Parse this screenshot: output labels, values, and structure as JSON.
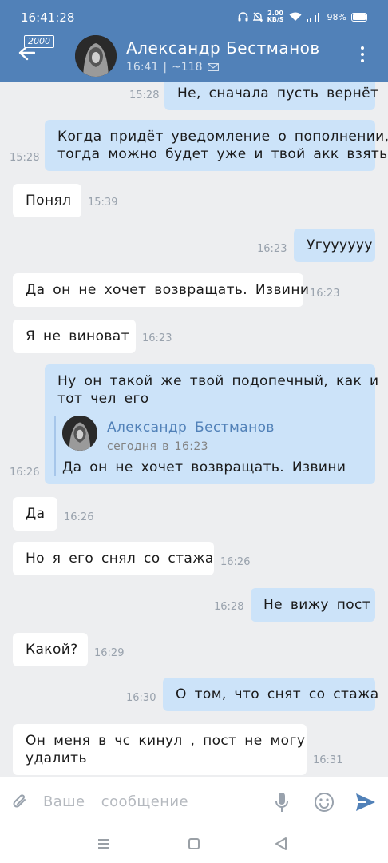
{
  "status_bar": {
    "time": "16:41:28",
    "net_speed_value": "2.00",
    "net_speed_unit": "KB/S",
    "battery": "98%"
  },
  "header": {
    "unread_badge": "2000",
    "contact_name": "Александр  Бестманов",
    "last_seen": "16:41",
    "separator": "|",
    "online_count": "~118",
    "icons": [
      "back-arrow-icon",
      "mail-icon",
      "more-vertical-icon"
    ]
  },
  "messages": [
    {
      "dir": "out",
      "text": [
        "Не,  сначала  пусть  вернёт"
      ],
      "time": "15:28"
    },
    {
      "dir": "out",
      "text": [
        "Когда  придёт  уведомление  о  пополнении,",
        "тогда  можно  будет  уже  и  твой  акк  взять"
      ],
      "time": "15:28"
    },
    {
      "dir": "in",
      "text": [
        "Понял"
      ],
      "time": "15:39"
    },
    {
      "dir": "out",
      "text": [
        "Угуууууу"
      ],
      "time": "16:23"
    },
    {
      "dir": "in",
      "text": [
        "Да  он  не  хочет  возвращать.  Извини"
      ],
      "time": "16:23"
    },
    {
      "dir": "in",
      "text": [
        "Я  не  виноват"
      ],
      "time": "16:23"
    },
    {
      "dir": "out",
      "text": [
        "Ну  он  такой  же  твой  подопечный,  как  и",
        "тот  чел  его"
      ],
      "time": "16:26",
      "forwarded": {
        "name": "Александр  Бестманов",
        "date": "сегодня  в  16:23",
        "text": "Да  он  не  хочет  возвращать.  Извини"
      }
    },
    {
      "dir": "in",
      "text": [
        "Да"
      ],
      "time": "16:26"
    },
    {
      "dir": "in",
      "text": [
        "Но  я  его  снял  со  стажа"
      ],
      "time": "16:26"
    },
    {
      "dir": "out",
      "text": [
        "Не  вижу  пост"
      ],
      "time": "16:28"
    },
    {
      "dir": "in",
      "text": [
        "Какой?"
      ],
      "time": "16:29"
    },
    {
      "dir": "out",
      "text": [
        "О  том,  что  снят  со  стажа"
      ],
      "time": "16:30"
    },
    {
      "dir": "in",
      "text": [
        "Он  меня  в  чс  кинул  ,  пост  не  могу",
        "удалить"
      ],
      "time": "16:31"
    }
  ],
  "composer": {
    "placeholder": "Ваше  сообщение",
    "icons": [
      "attach-icon",
      "microphone-icon",
      "emoji-icon",
      "send-icon"
    ]
  },
  "colors": {
    "header": "#5181b8",
    "chat_bg": "#edeef0",
    "bubble_in": "#ffffff",
    "bubble_out": "#cce3f9",
    "link": "#5181b8"
  }
}
